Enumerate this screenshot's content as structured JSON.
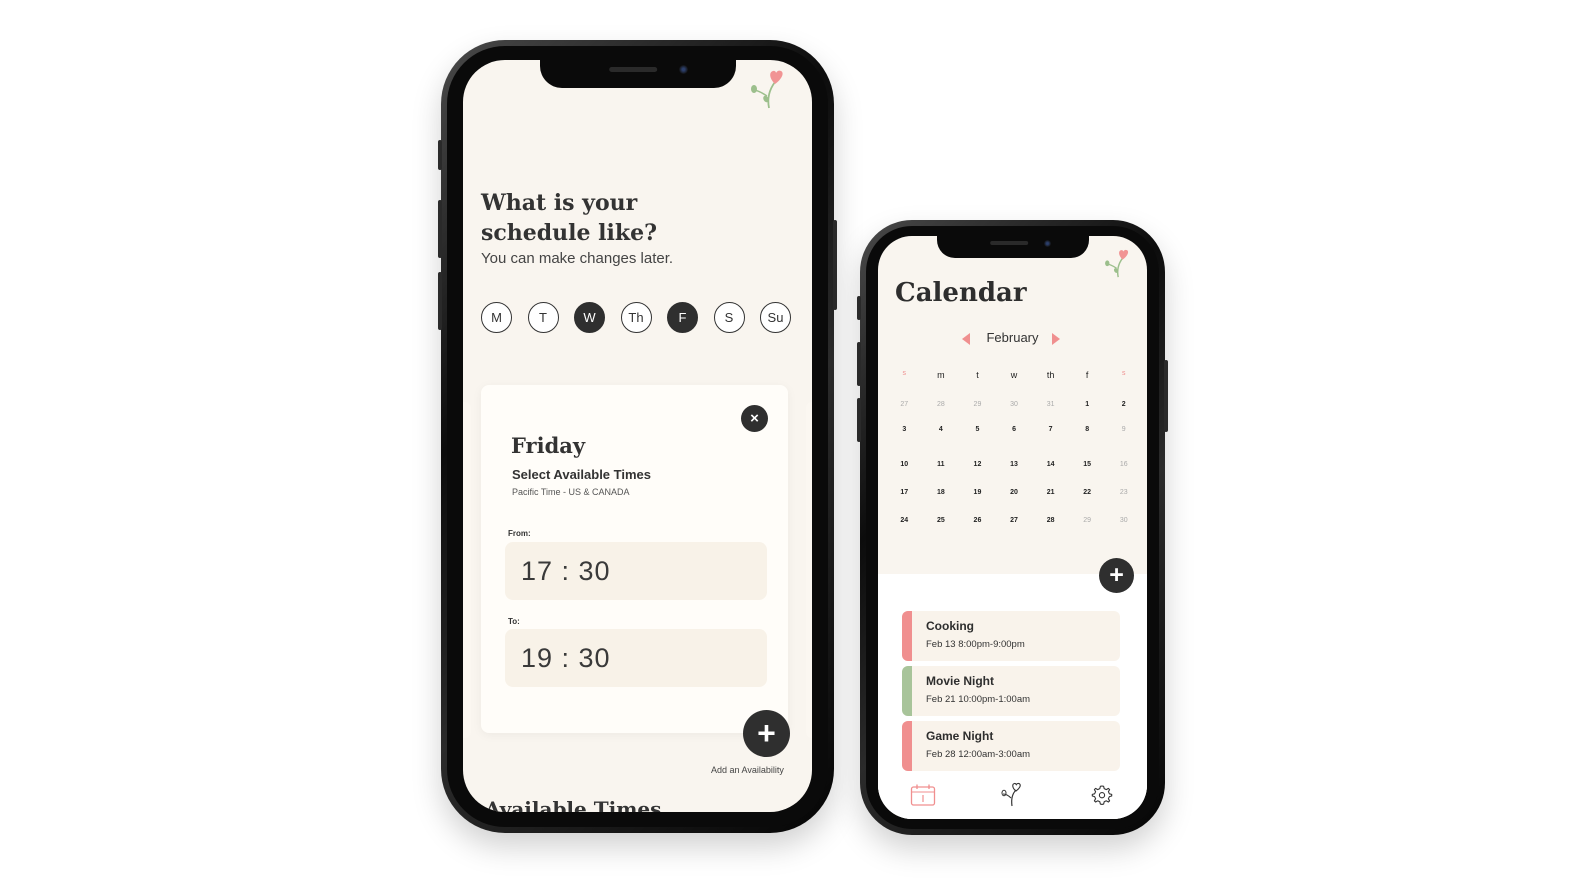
{
  "screen1": {
    "title": "What is your schedule like?",
    "subtitle": "You can make changes later.",
    "days": [
      {
        "label": "M",
        "selected": false
      },
      {
        "label": "T",
        "selected": false
      },
      {
        "label": "W",
        "selected": true
      },
      {
        "label": "Th",
        "selected": false
      },
      {
        "label": "F",
        "selected": true
      },
      {
        "label": "S",
        "selected": false
      },
      {
        "label": "Su",
        "selected": false
      }
    ],
    "card": {
      "close_icon": "×",
      "day": "Friday",
      "heading": "Select Available Times",
      "timezone": "Pacific Time - US & CANADA",
      "from_label": "From:",
      "from_value": "17 : 30",
      "to_label": "To:",
      "to_value": "19 : 30"
    },
    "add_icon": "+",
    "add_label": "Add an Availability",
    "next_section": "Available Times"
  },
  "screen2": {
    "title": "Calendar",
    "month": "February",
    "weekdays": [
      {
        "label": "s",
        "weekend": true
      },
      {
        "label": "m",
        "weekend": false
      },
      {
        "label": "t",
        "weekend": false
      },
      {
        "label": "w",
        "weekend": false
      },
      {
        "label": "th",
        "weekend": false
      },
      {
        "label": "f",
        "weekend": false
      },
      {
        "label": "s",
        "weekend": true
      }
    ],
    "weeks": [
      [
        "27",
        "28",
        "29",
        "30",
        "31",
        "1",
        "2"
      ],
      [
        "3",
        "4",
        "5",
        "6",
        "7",
        "8",
        "9"
      ],
      [
        "10",
        "11",
        "12",
        "13",
        "14",
        "15",
        "16"
      ],
      [
        "17",
        "18",
        "19",
        "20",
        "21",
        "22",
        "23"
      ],
      [
        "24",
        "25",
        "26",
        "27",
        "28",
        "29",
        "30"
      ]
    ],
    "muted_cells": [
      [
        0,
        0
      ],
      [
        0,
        1
      ],
      [
        0,
        2
      ],
      [
        0,
        3
      ],
      [
        0,
        4
      ],
      [
        1,
        6
      ],
      [
        2,
        6
      ],
      [
        3,
        6
      ],
      [
        4,
        5
      ],
      [
        4,
        6
      ]
    ],
    "add_icon": "+",
    "events": [
      {
        "name": "Cooking",
        "time": "Feb 13 8:00pm-9:00pm",
        "color": "#f08f8f"
      },
      {
        "name": "Movie Night",
        "time": "Feb 21 10:00pm-1:00am",
        "color": "#a8c49a"
      },
      {
        "name": "Game Night",
        "time": "Feb 28 12:00am-3:00am",
        "color": "#f08f8f"
      }
    ],
    "tabs": [
      "calendar-icon",
      "flower-icon",
      "gear-icon"
    ]
  },
  "colors": {
    "accent": "#f08f8f",
    "green": "#a8c49a",
    "screen_bg": "#f9f5ef",
    "dark": "#2f2f2f"
  }
}
